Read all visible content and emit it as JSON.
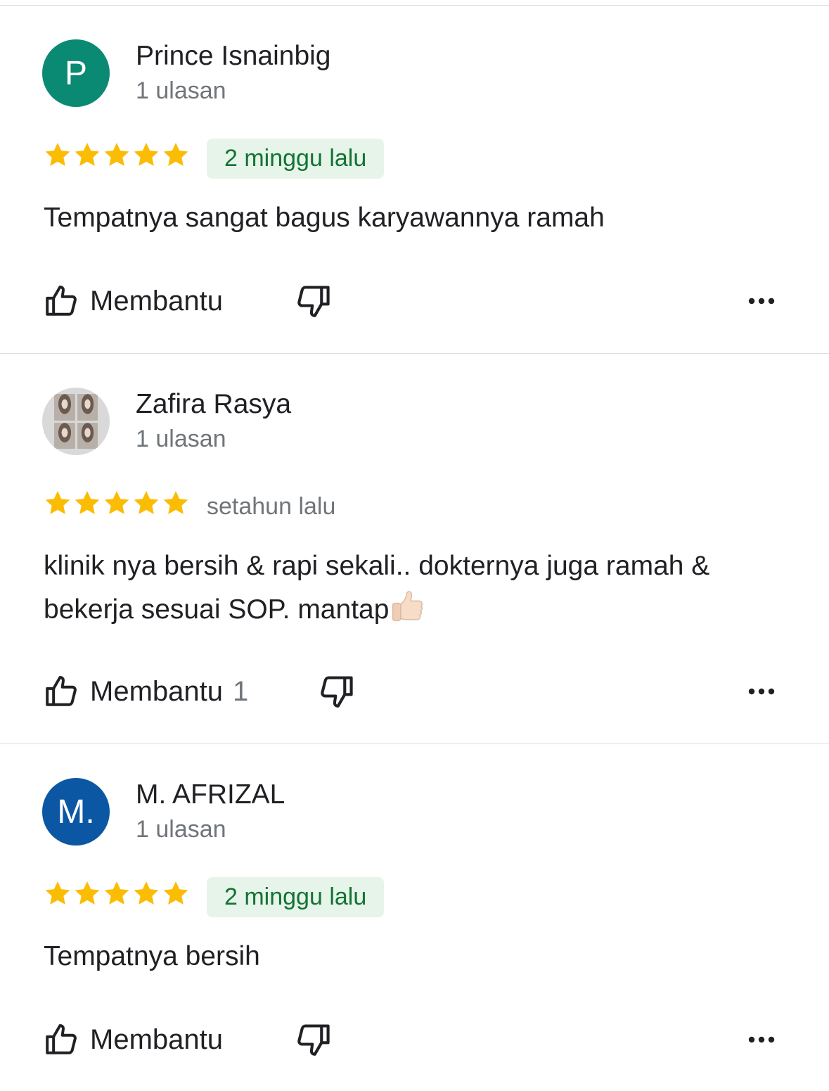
{
  "colors": {
    "star": "#fbbc04",
    "badge_bg": "#e6f4ea",
    "badge_text": "#137333",
    "secondary_text": "#70757a",
    "avatar_p": "#0b8a73",
    "avatar_m": "#0b57a4"
  },
  "reviews": [
    {
      "avatar_letter": "P",
      "avatar_color": "#0b8a73",
      "name": "Prince Isnainbig",
      "review_count": "1 ulasan",
      "rating": 5,
      "date": "2 minggu lalu",
      "date_style": "badge",
      "text": "Tempatnya sangat bagus karyawannya ramah",
      "helpful_label": "Membantu",
      "helpful_count": ""
    },
    {
      "avatar_letter": "",
      "avatar_color": "#d9d9d9",
      "name": "Zafira Rasya",
      "review_count": "1 ulasan",
      "rating": 5,
      "date": "setahun lalu",
      "date_style": "plain",
      "text": "klinik nya bersih & rapi sekali.. dokternya juga ramah & bekerja sesuai SOP. mantap",
      "text_emoji": "thumbs-up-emoji",
      "helpful_label": "Membantu",
      "helpful_count": "1"
    },
    {
      "avatar_letter": "M.",
      "avatar_color": "#0b57a4",
      "name": "M. AFRIZAL",
      "review_count": "1 ulasan",
      "rating": 5,
      "date": "2 minggu lalu",
      "date_style": "badge",
      "text": "Tempatnya bersih",
      "helpful_label": "Membantu",
      "helpful_count": ""
    }
  ],
  "icons": {
    "helpful": "thumb-up-outline-icon",
    "not_helpful": "thumb-down-outline-icon",
    "more": "more-horizontal-icon",
    "star": "star-icon"
  }
}
